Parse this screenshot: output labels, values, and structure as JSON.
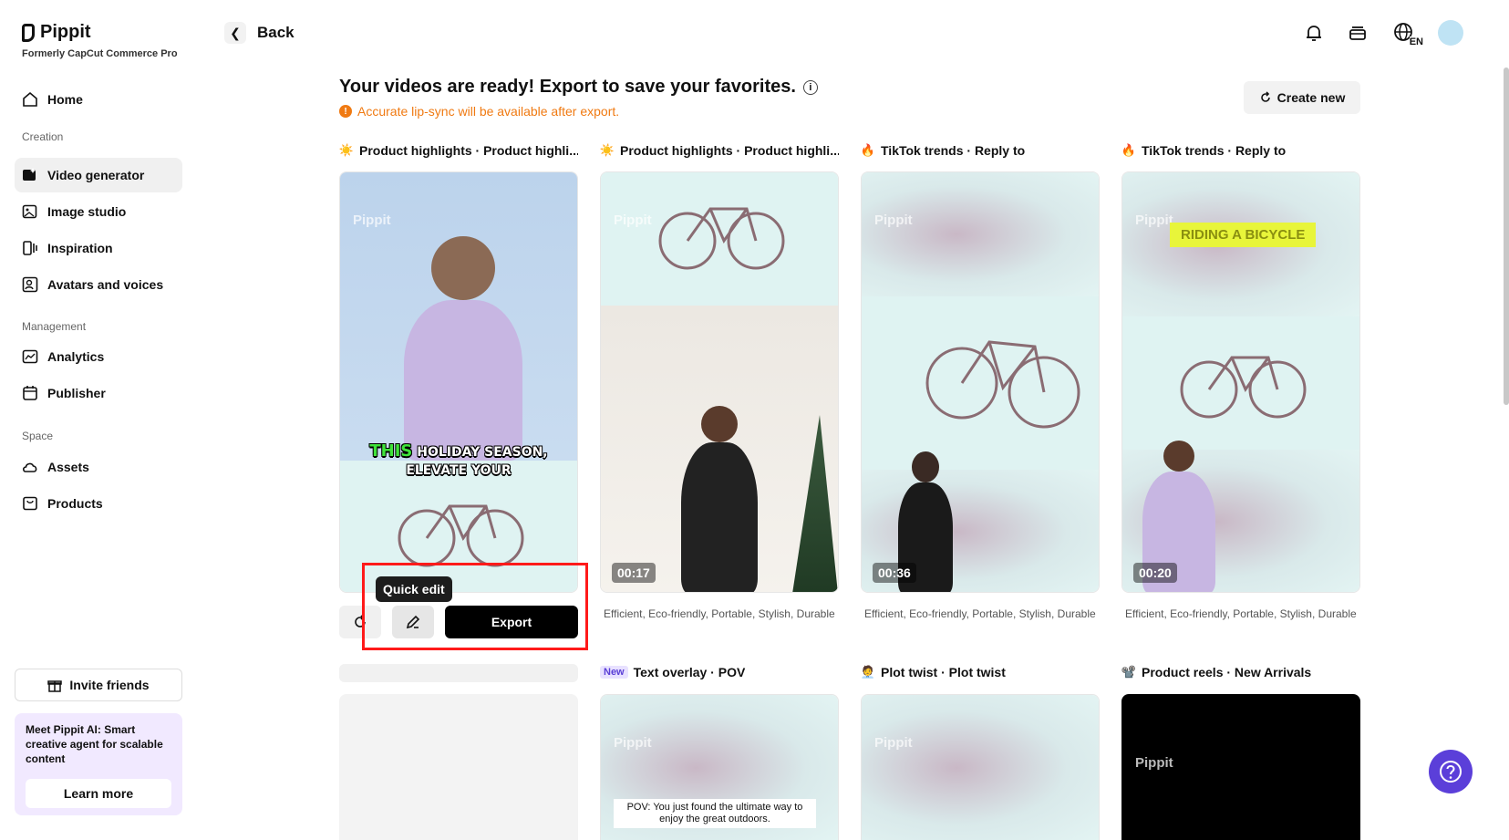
{
  "sidebar": {
    "brand": "Pippit",
    "subtitle": "Formerly CapCut Commerce Pro",
    "home": "Home",
    "sections": {
      "creation": "Creation",
      "management": "Management",
      "space": "Space"
    },
    "items": {
      "video_generator": "Video generator",
      "image_studio": "Image studio",
      "inspiration": "Inspiration",
      "avatars": "Avatars and voices",
      "analytics": "Analytics",
      "publisher": "Publisher",
      "assets": "Assets",
      "products": "Products"
    },
    "invite": "Invite friends",
    "promo_text": "Meet Pippit AI: Smart creative agent for scalable content",
    "promo_button": "Learn more"
  },
  "header": {
    "back": "Back",
    "lang": "EN"
  },
  "main": {
    "heading": "Your videos are ready! Export to save your favorites.",
    "notice": "Accurate lip-sync will be available after export.",
    "create_new": "Create new",
    "watermark": "Pippit",
    "tooltip": "Quick edit",
    "export_label": "Export",
    "cards": [
      {
        "title": "Product highlights · Product highli...",
        "duration": "",
        "caption_a": "THIS HOLIDAY SEASON,",
        "caption_b": "ELEVATE YOUR",
        "tags": ""
      },
      {
        "title": "Product highlights · Product highli...",
        "duration": "00:17",
        "tags": "Efficient, Eco-friendly, Portable, Stylish, Durable"
      },
      {
        "title": "TikTok trends · Reply to",
        "duration": "00:36",
        "tags": "Efficient, Eco-friendly, Portable, Stylish, Durable"
      },
      {
        "title": "TikTok trends · Reply to",
        "duration": "00:20",
        "overlay": "RIDING A BICYCLE",
        "tags": "Efficient, Eco-friendly, Portable, Stylish, Durable"
      }
    ],
    "row2": [
      {
        "badge": "New",
        "title": "Text overlay · POV",
        "caption": "POV: You just found the ultimate way to enjoy the great outdoors."
      },
      {
        "title": "Plot twist · Plot twist"
      },
      {
        "title": "Product reels · New Arrivals"
      }
    ]
  },
  "colors": {
    "accent": "#5b3fd9",
    "warning": "#f07a12",
    "highlight": "#ff1a1a"
  }
}
